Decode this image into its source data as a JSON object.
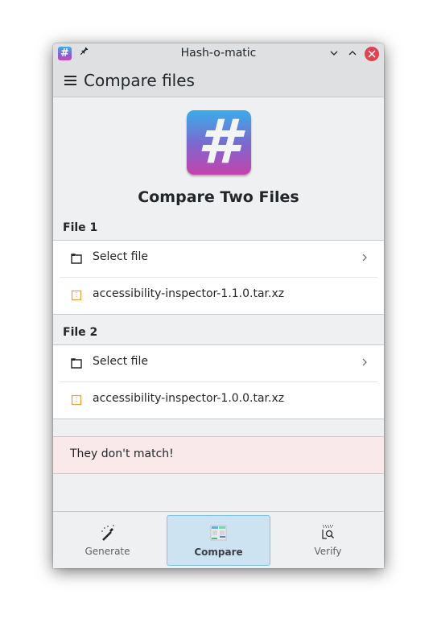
{
  "window": {
    "title": "Hash-o-matic",
    "controls": [
      "minimize",
      "maximize",
      "close"
    ]
  },
  "header": {
    "page_title": "Compare files"
  },
  "main": {
    "heading": "Compare Two Files",
    "files": [
      {
        "label": "File 1",
        "select_label": "Select file",
        "selected_file": "accessibility-inspector-1.1.0.tar.xz"
      },
      {
        "label": "File 2",
        "select_label": "Select file",
        "selected_file": "accessibility-inspector-1.0.0.tar.xz"
      }
    ],
    "result_message": "They don't match!"
  },
  "nav": {
    "tabs": [
      {
        "label": "Generate",
        "icon": "magic-wand-icon",
        "active": false
      },
      {
        "label": "Compare",
        "icon": "compare-icon",
        "active": true
      },
      {
        "label": "Verify",
        "icon": "verify-icon",
        "active": false
      }
    ]
  },
  "colors": {
    "accent": "#3daee9",
    "close_button": "#e0424f",
    "alert_background": "#f9e9ea",
    "archive_icon": "#e9a23b"
  }
}
